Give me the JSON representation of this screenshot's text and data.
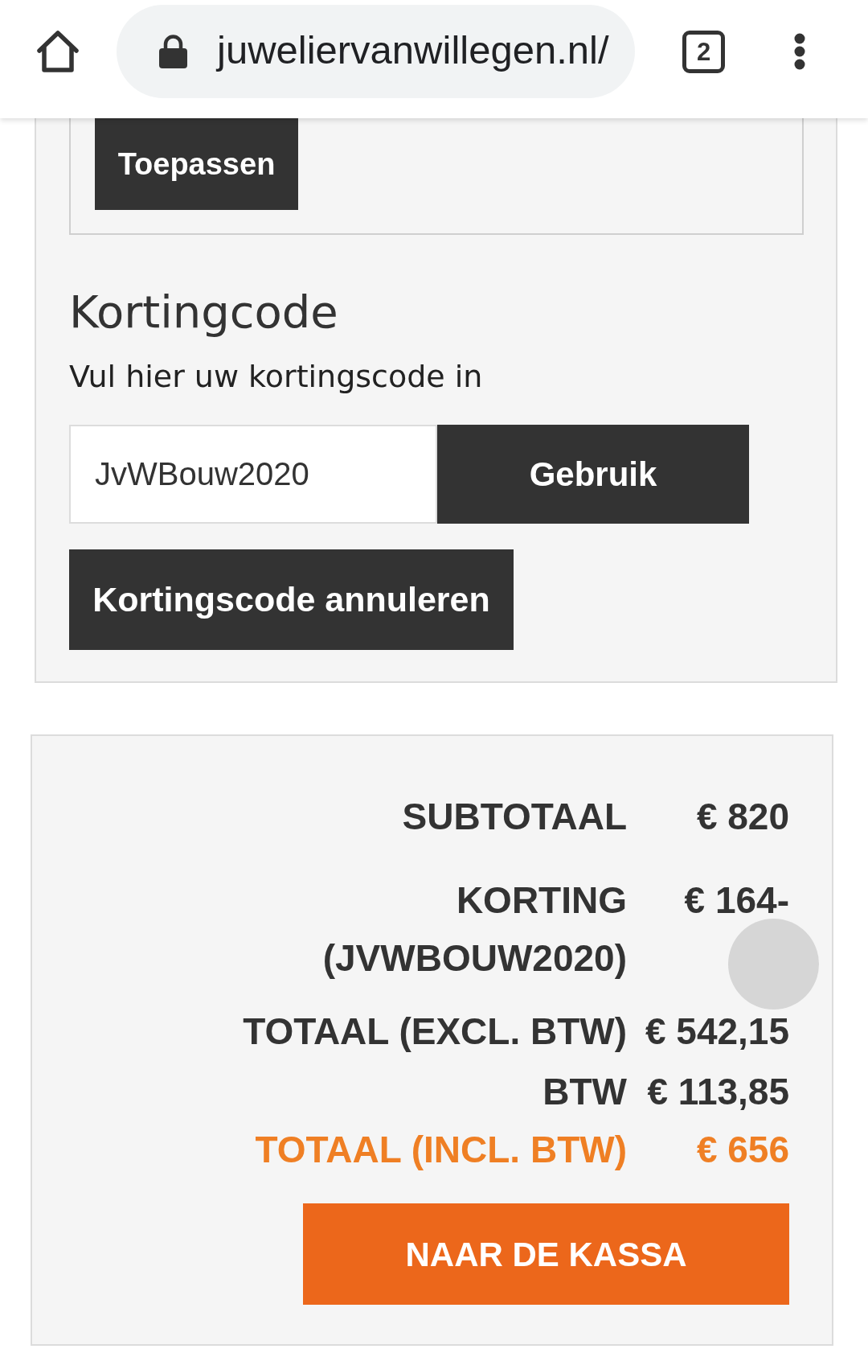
{
  "browser_bar": {
    "url": "juweliervanwillegen.nl/",
    "tab_count": "2"
  },
  "previous_section": {
    "button": "Toepassen"
  },
  "discount_code": {
    "title": "Kortingcode",
    "instruction": "Vul hier uw kortingscode in",
    "code_field": {
      "value": "JvWBouw2020"
    },
    "apply_button": "Gebruik",
    "cancel_button": "Kortingscode annuleren"
  },
  "totals": {
    "rows": [
      {
        "label": "SUBTOTAAL",
        "value": "€ 820",
        "highlighted": false
      },
      {
        "label": "KORTING (JVWBOUW2020)",
        "value": "€ 164-",
        "highlighted": false
      },
      {
        "label": "TOTAAL (EXCL. BTW)",
        "value": "€ 542,15",
        "highlighted": false
      },
      {
        "label": "BTW",
        "value": "€ 113,85",
        "highlighted": false
      },
      {
        "label": "TOTAAL (INCL. BTW)",
        "value": "€ 656",
        "highlighted": true
      }
    ],
    "checkout_button": "NAAR DE KASSA"
  }
}
